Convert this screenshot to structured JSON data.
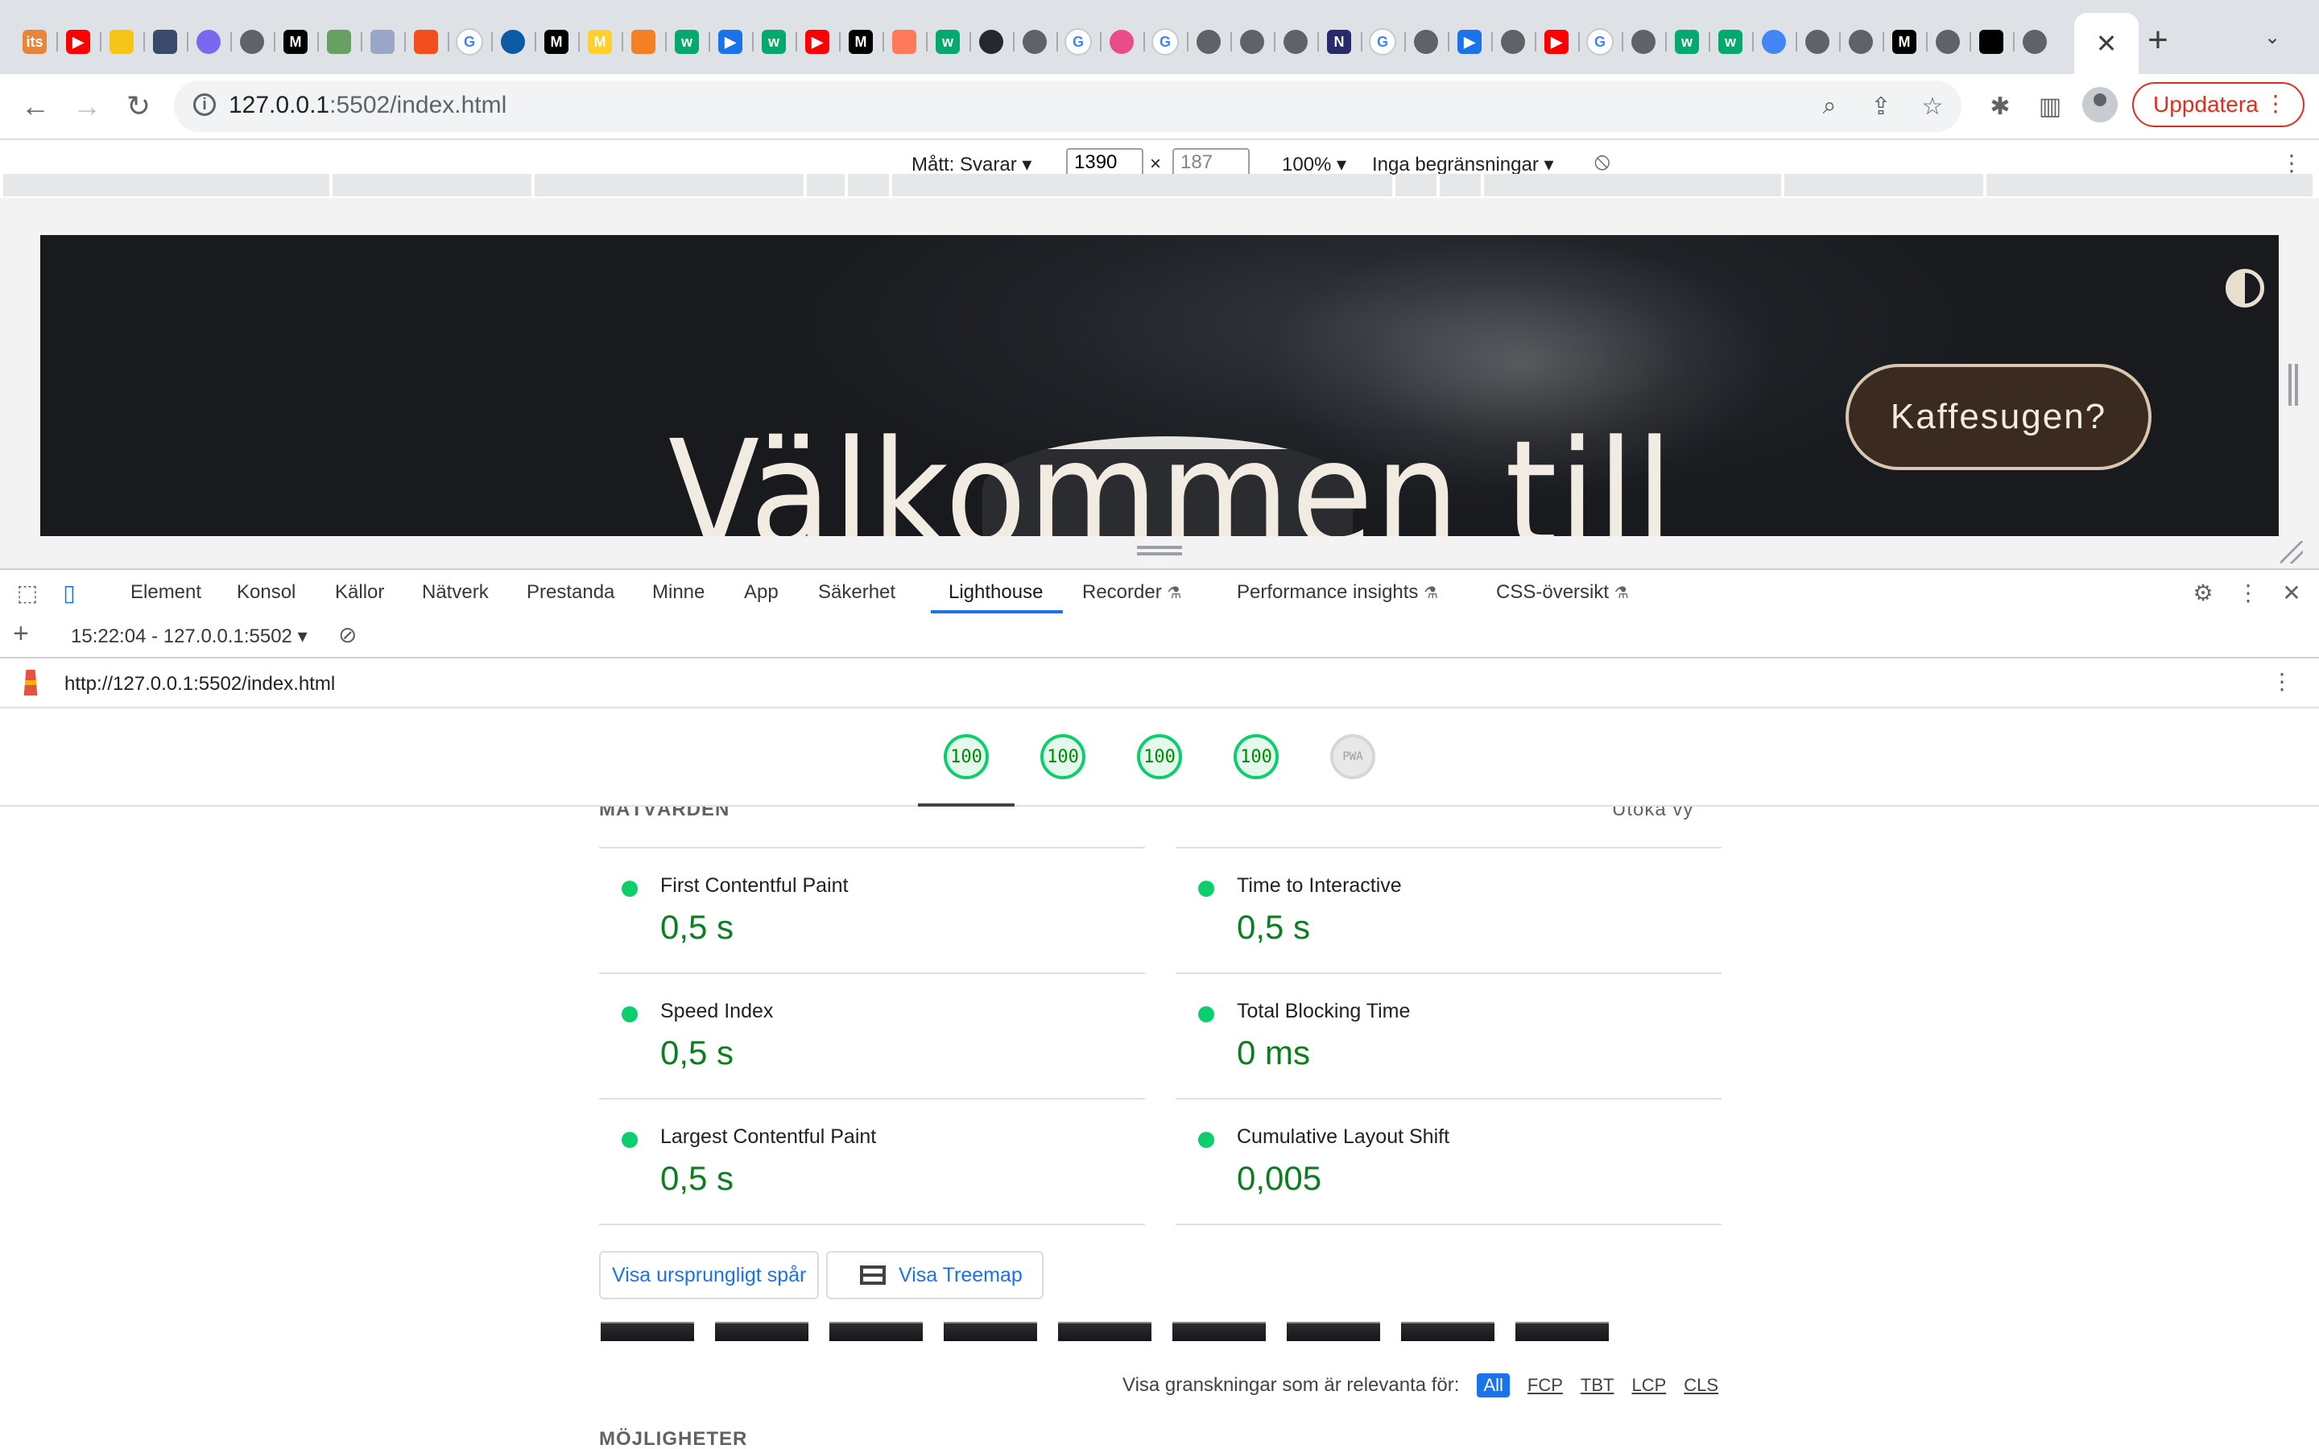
{
  "browser": {
    "favicons": [
      {
        "icon": "its-icon",
        "text": "its",
        "color": "#e8853a"
      },
      {
        "icon": "youtube-icon",
        "text": "▶",
        "color": "#ff0000"
      },
      {
        "icon": "lightbulb-icon",
        "text": "",
        "color": "#f5c518"
      },
      {
        "icon": "ua-icon",
        "text": "",
        "color": "#3b4a6b"
      },
      {
        "icon": "clickup-icon",
        "text": "",
        "color": "#7b68ee"
      },
      {
        "icon": "globe-icon",
        "text": "",
        "color": "#5f6368"
      },
      {
        "icon": "medium-icon",
        "text": "M",
        "color": "#000000"
      },
      {
        "icon": "node-icon",
        "text": "",
        "color": "#68a063"
      },
      {
        "icon": "tab-icon",
        "text": "",
        "color": "#9aa6c6"
      },
      {
        "icon": "figma-icon",
        "text": "",
        "color": "#f24e1e"
      },
      {
        "icon": "google-icon",
        "text": "G",
        "color": "#4285f4"
      },
      {
        "icon": "edge-icon",
        "text": "",
        "color": "#0c59a4"
      },
      {
        "icon": "medium-icon",
        "text": "M",
        "color": "#000000"
      },
      {
        "icon": "miro-icon",
        "text": "M",
        "color": "#ffd02f"
      },
      {
        "icon": "stackoverflow-icon",
        "text": "",
        "color": "#f48024"
      },
      {
        "icon": "w3schools-icon",
        "text": "w",
        "color": "#04aa6d"
      },
      {
        "icon": "play-icon",
        "text": "▶",
        "color": "#1a73e8"
      },
      {
        "icon": "w3schools-icon",
        "text": "w",
        "color": "#04aa6d"
      },
      {
        "icon": "youtube-icon",
        "text": "▶",
        "color": "#ff0000"
      },
      {
        "icon": "medium-icon",
        "text": "M",
        "color": "#000000"
      },
      {
        "icon": "hubspot-icon",
        "text": "",
        "color": "#ff7a59"
      },
      {
        "icon": "w3schools-icon",
        "text": "w",
        "color": "#04aa6d"
      },
      {
        "icon": "github-icon",
        "text": "",
        "color": "#24292e"
      },
      {
        "icon": "globe-icon",
        "text": "",
        "color": "#5f6368"
      },
      {
        "icon": "google-icon",
        "text": "G",
        "color": "#4285f4"
      },
      {
        "icon": "dribbble-icon",
        "text": "",
        "color": "#ea4c89"
      },
      {
        "icon": "google-icon",
        "text": "G",
        "color": "#4285f4"
      },
      {
        "icon": "globe-icon",
        "text": "",
        "color": "#5f6368"
      },
      {
        "icon": "globe-icon",
        "text": "",
        "color": "#5f6368"
      },
      {
        "icon": "globe-icon",
        "text": "",
        "color": "#5f6368"
      },
      {
        "icon": "nu-icon",
        "text": "N",
        "color": "#2a2a6b"
      },
      {
        "icon": "google-icon",
        "text": "G",
        "color": "#4285f4"
      },
      {
        "icon": "globe-icon",
        "text": "",
        "color": "#5f6368"
      },
      {
        "icon": "play-icon",
        "text": "▶",
        "color": "#1a73e8"
      },
      {
        "icon": "globe-icon",
        "text": "",
        "color": "#5f6368"
      },
      {
        "icon": "youtube-icon",
        "text": "▶",
        "color": "#ff0000"
      },
      {
        "icon": "google-icon",
        "text": "G",
        "color": "#4285f4"
      },
      {
        "icon": "globe-icon",
        "text": "",
        "color": "#5f6368"
      },
      {
        "icon": "w3schools-icon",
        "text": "w",
        "color": "#04aa6d"
      },
      {
        "icon": "w3schools-icon",
        "text": "w",
        "color": "#04aa6d"
      },
      {
        "icon": "google-lens-icon",
        "text": "",
        "color": "#4285f4"
      },
      {
        "icon": "globe-icon",
        "text": "",
        "color": "#5f6368"
      },
      {
        "icon": "globe-icon",
        "text": "",
        "color": "#5f6368"
      },
      {
        "icon": "medium-icon",
        "text": "M",
        "color": "#000000"
      },
      {
        "icon": "globe-icon",
        "text": "",
        "color": "#5f6368"
      },
      {
        "icon": "qr-icon",
        "text": "",
        "color": "#000000"
      },
      {
        "icon": "globe-icon",
        "text": "",
        "color": "#5f6368"
      }
    ],
    "close_tab": "✕",
    "new_tab": "+",
    "url_host": "127.0.0.1",
    "url_rest": ":5502/index.html",
    "update_label": "Uppdatera"
  },
  "device_toolbar": {
    "dimensions_label": "Mått: Svarar",
    "width": "1390",
    "height": "187",
    "times": "×",
    "zoom": "100%",
    "throttling": "Inga begränsningar"
  },
  "page": {
    "hero_title": "Välkommen till",
    "cta_label": "Kaffesugen?"
  },
  "devtools": {
    "tabs": [
      "Element",
      "Konsol",
      "Källor",
      "Nätverk",
      "Prestanda",
      "Minne",
      "App",
      "Säkerhet",
      "Lighthouse",
      "Recorder",
      "Performance insights",
      "CSS-översikt"
    ],
    "run_label": "15:22:04 - 127.0.0.1:5502",
    "report_url": "http://127.0.0.1:5502/index.html",
    "scores": [
      "100",
      "100",
      "100",
      "100"
    ],
    "pwa_label": "PWA"
  },
  "report": {
    "metrics_title": "MÄTVÄRDEN",
    "expand_label": "Utöka vy",
    "metrics": [
      {
        "label": "First Contentful Paint",
        "value": "0,5 s"
      },
      {
        "label": "Time to Interactive",
        "value": "0,5 s"
      },
      {
        "label": "Speed Index",
        "value": "0,5 s"
      },
      {
        "label": "Total Blocking Time",
        "value": "0 ms"
      },
      {
        "label": "Largest Contentful Paint",
        "value": "0,5 s"
      },
      {
        "label": "Cumulative Layout Shift",
        "value": "0,005"
      }
    ],
    "view_trace_label": "Visa ursprungligt spår",
    "view_treemap_label": "Visa Treemap",
    "filter_label": "Visa granskningar som är relevanta för:",
    "filters": [
      "All",
      "FCP",
      "TBT",
      "LCP",
      "CLS"
    ],
    "opportunities_title": "MÖJLIGHETER"
  },
  "colors": {
    "pass_green": "#0cce6b",
    "value_green": "#0c7d20",
    "link_blue": "#1a73e8",
    "update_red": "#d93025",
    "hero_text": "#f2ebe1",
    "cta_bg": "#3a2a20"
  }
}
